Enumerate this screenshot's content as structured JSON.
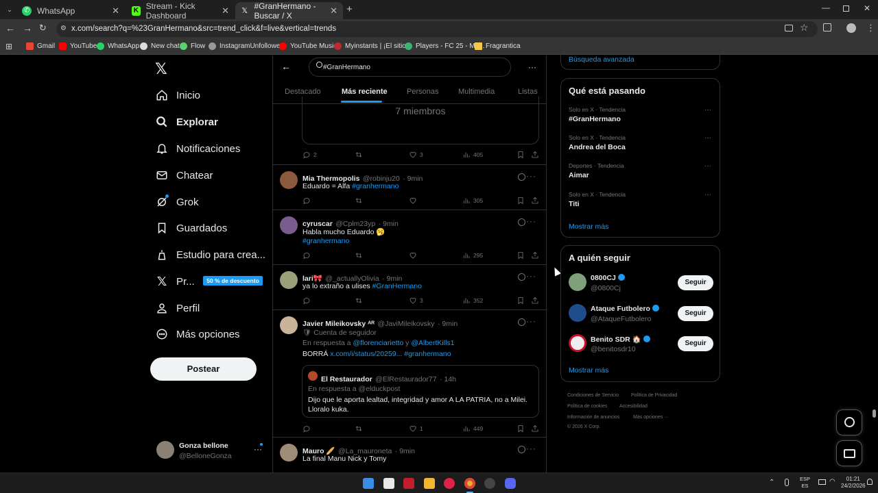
{
  "browser": {
    "tabs": [
      {
        "title": "WhatsApp"
      },
      {
        "title": "Stream - Kick Dashboard"
      },
      {
        "title": "#GranHermano - Buscar / X"
      }
    ],
    "url": "x.com/search?q=%23GranHermano&src=trend_click&f=live&vertical=trends",
    "bookmarks": [
      "Gmail",
      "YouTube",
      "WhatsApp",
      "New chat",
      "Flow",
      "InstagramUnfollowers",
      "YouTube Music",
      "Myinstants | ¡El sitio...",
      "Players - FC 25 - Ma...",
      "Fragrantica"
    ]
  },
  "sidebar": {
    "items": [
      "Inicio",
      "Explorar",
      "Notificaciones",
      "Chatear",
      "Grok",
      "Guardados",
      "Estudio para crea...",
      "Pr...",
      "Perfil",
      "Más opciones"
    ],
    "premium_badge": "50 % de descuento",
    "post_button": "Postear",
    "user_name": "Gonza bellone",
    "user_handle": "@BelloneGonza"
  },
  "search": {
    "query": "#GranHermano",
    "tabs": [
      "Destacado",
      "Más reciente",
      "Personas",
      "Multimedia",
      "Listas"
    ],
    "active_tab": "Más reciente"
  },
  "feed": {
    "community_members": "7 miembros",
    "first_stats": {
      "replies": "2",
      "likes": "3",
      "views": "405"
    },
    "tweets": [
      {
        "name": "Mia Thermopolis",
        "handle": "@robinju20",
        "time": "· 9min",
        "text": "Eduardo = Alfa ",
        "tag": "#granhermano",
        "likes": "",
        "reposts": "",
        "views": "305"
      },
      {
        "name": "cyruscar",
        "handle": "@Cplm23yp",
        "time": "· 9min",
        "text": "Habla mucho Eduardo 🥱",
        "tag": "#granhermano",
        "views": "295"
      },
      {
        "name": "lari🎀",
        "handle": "@_actuallyOlivia",
        "time": "· 9min",
        "text": "ya lo extraño a ulises ",
        "tag": "#GranHermano",
        "likes": "3",
        "views": "352"
      },
      {
        "name": "Javier Mileikovsky ᴬᴿ",
        "handle": "@JaviMileikovsky",
        "time": "· 9min",
        "follower_note": "Cuenta de seguidor",
        "reply_to_label": "En respuesta a ",
        "reply_to_1": "@florenciarietto",
        "reply_and": " y ",
        "reply_to_2": "@AlbertKills1",
        "text": "BORRÁ ",
        "link": "x.com/i/status/20259...",
        "tag": " #granhermano",
        "likes": "1",
        "views": "449",
        "quote": {
          "name": "El Restaurador",
          "handle": "@ElRestaurador77",
          "time": "· 14h",
          "reply_to": "En respuesta a @elduckpost",
          "text": "Dijo que le aporta lealtad, integridad y amor A LA PATRIA, no a Milei. Lloralo kuka."
        }
      },
      {
        "name": "Mauro 🥖",
        "handle": "@La_mauroneta",
        "time": "· 9min",
        "text": "La final Manu Nick y Tomy"
      }
    ]
  },
  "right": {
    "advanced_search": "Búsqueda avanzada",
    "trends_title": "Qué está pasando",
    "trends": [
      {
        "sub": "Solo en X · Tendencia",
        "name": "#GranHermano"
      },
      {
        "sub": "Solo en X · Tendencia",
        "name": "Andrea del Boca"
      },
      {
        "sub": "Deportes · Tendencia",
        "name": "Aimar"
      },
      {
        "sub": "Solo en X · Tendencia",
        "name": "Titi"
      }
    ],
    "show_more": "Mostrar más",
    "follow_title": "A quién seguir",
    "follow": [
      {
        "name": "0800CJ",
        "handle": "@0800Cj"
      },
      {
        "name": "Ataque Futbolero",
        "handle": "@AtaqueFutbolero"
      },
      {
        "name": "Benito SDR 🏠",
        "handle": "@benitosdr10"
      }
    ],
    "follow_button": "Seguir",
    "footer": [
      "Condiciones de Servicio",
      "Política de Privacidad",
      "Política de cookies",
      "Accesibilidad",
      "Información de anuncios",
      "Más opciones ···",
      "© 2026 X Corp."
    ]
  },
  "taskbar": {
    "lang1": "ESP",
    "lang2": "ES",
    "time": "01:21",
    "date": "24/2/2026"
  },
  "colors": {
    "accent": "#1d9bf0",
    "bg": "#000000",
    "border": "#2f3336",
    "muted": "#71767b",
    "premium": "#1d9bf0"
  }
}
